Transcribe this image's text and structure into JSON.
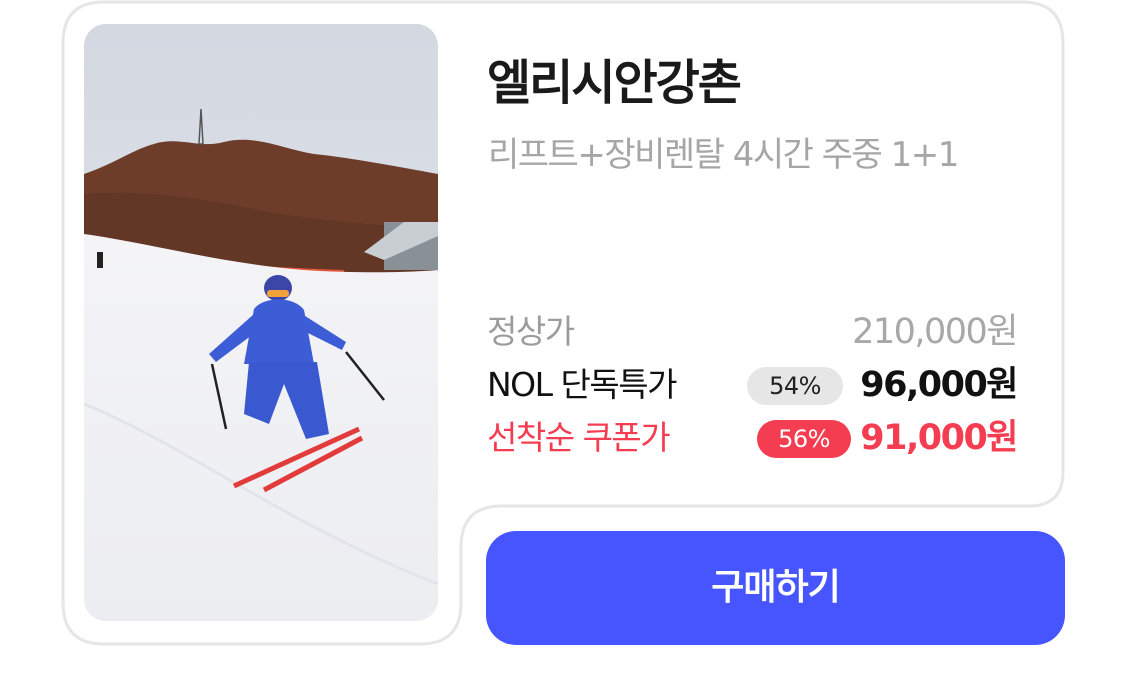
{
  "product": {
    "title": "엘리시안강촌",
    "subtitle": "리프트+장비렌탈 4시간 주중 1+1",
    "image_description_icon": "skier-photo"
  },
  "pricing": {
    "regular": {
      "label": "정상가",
      "price": "210,000원"
    },
    "sale": {
      "label": "NOL 단독특가",
      "discount": "54%",
      "price": "96,000원"
    },
    "coupon": {
      "label": "선착순 쿠폰가",
      "discount": "56%",
      "price": "91,000원"
    }
  },
  "actions": {
    "buy_label": "구매하기"
  },
  "colors": {
    "accent": "#4655ff",
    "coupon_red": "#f53d52",
    "card_border": "#e6e6e6",
    "muted_text": "#a6a6a6"
  }
}
